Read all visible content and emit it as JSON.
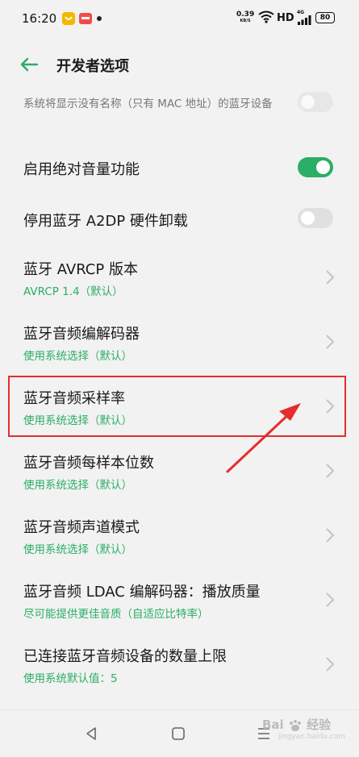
{
  "status_bar": {
    "time": "16:20",
    "net_speed_value": "0.39",
    "net_speed_unit": "KB/S",
    "hd_label": "HD",
    "network_label": "4G",
    "battery": "80"
  },
  "header": {
    "title": "开发者选项"
  },
  "items": [
    {
      "subtitle": "系统将显示没有名称（只有 MAC 地址）的蓝牙设备",
      "toggle_on": false
    },
    {
      "title": "启用绝对音量功能",
      "toggle_on": true
    },
    {
      "title": "停用蓝牙 A2DP 硬件卸载",
      "toggle_on": false
    },
    {
      "title": "蓝牙 AVRCP 版本",
      "subtitle": "AVRCP 1.4（默认）"
    },
    {
      "title": "蓝牙音频编解码器",
      "subtitle": "使用系统选择（默认）"
    },
    {
      "title": "蓝牙音频采样率",
      "subtitle": "使用系统选择（默认）"
    },
    {
      "title": "蓝牙音频每样本位数",
      "subtitle": "使用系统选择（默认）"
    },
    {
      "title": "蓝牙音频声道模式",
      "subtitle": "使用系统选择（默认）"
    },
    {
      "title": "蓝牙音频 LDAC 编解码器：播放质量",
      "subtitle": "尽可能提供更佳音质（自适应比特率）"
    },
    {
      "title": "已连接蓝牙音频设备的数量上限",
      "subtitle": "使用系统默认值：5"
    }
  ],
  "watermark": {
    "brand": "Bai",
    "brand_suffix": "经验",
    "domain": "jingyan.baidu.com"
  },
  "colors": {
    "accent": "#2bae66",
    "highlight": "#e62d2d"
  }
}
